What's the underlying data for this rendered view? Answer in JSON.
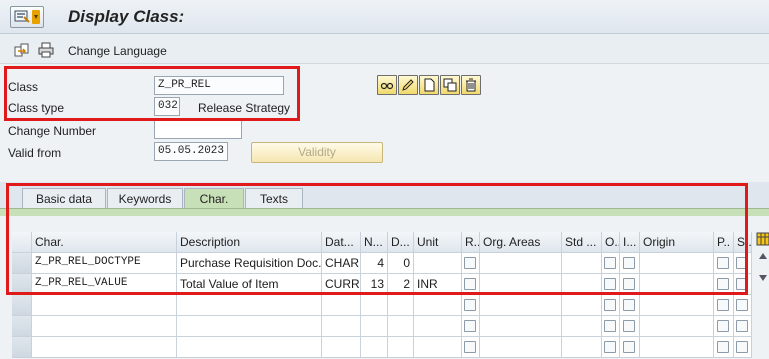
{
  "window": {
    "title": "Display Class:"
  },
  "toolbar": {
    "change_language": "Change Language"
  },
  "form": {
    "class_label": "Class",
    "class_value": "Z_PR_REL",
    "class_type_label": "Class type",
    "class_type_value": "032",
    "class_type_desc": "Release Strategy",
    "change_number_label": "Change Number",
    "change_number_value": "",
    "valid_from_label": "Valid from",
    "valid_from_value": "05.05.2023",
    "validity_button": "Validity"
  },
  "tabs": [
    {
      "label": "Basic data"
    },
    {
      "label": "Keywords"
    },
    {
      "label": "Char."
    },
    {
      "label": "Texts"
    }
  ],
  "grid": {
    "headers": [
      "Char.",
      "Description",
      "Dat...",
      "N...",
      "D...",
      "Unit",
      "R..",
      "Org. Areas",
      "Std ...",
      "O..",
      "I...",
      "Origin",
      "P..",
      "S.."
    ],
    "rows": [
      {
        "char": "Z_PR_REL_DOCTYPE",
        "description": "Purchase Requisition Doc...",
        "datatype": "CHAR",
        "num": "4",
        "dec": "0",
        "unit": ""
      },
      {
        "char": "Z_PR_REL_VALUE",
        "description": "Total Value of Item",
        "datatype": "CURR",
        "num": "13",
        "dec": "2",
        "unit": "INR"
      }
    ]
  },
  "colors": {
    "highlight": "#e0191b",
    "active_tab": "#c8e0b7"
  }
}
